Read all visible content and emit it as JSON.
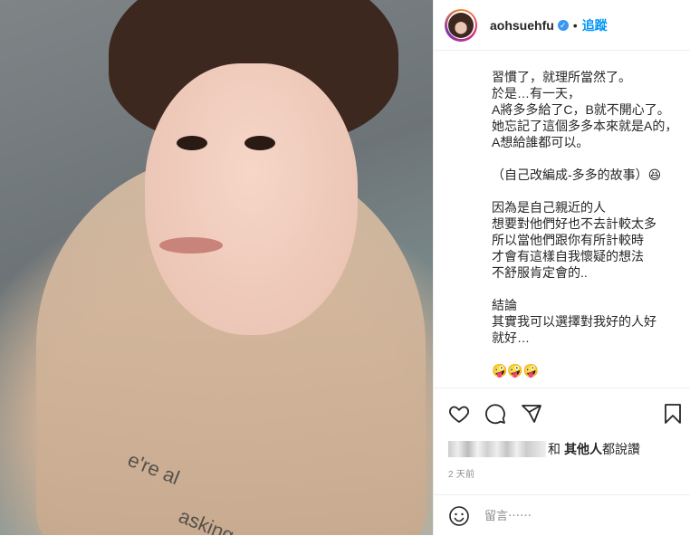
{
  "photo": {
    "slogan_line1": "e're al",
    "slogan_line2": "asking"
  },
  "header": {
    "username": "aohsuehfu",
    "verified_mark": "✓",
    "separator": "•",
    "follow_label": "追蹤"
  },
  "caption": {
    "text": "習慣了，就理所當然了。\n於是…有一天，\nA將多多給了C，B就不開心了。\n她忘記了這個多多本來就是A的，\nA想給誰都可以。\n\n（自己改編成-多多的故事）😆\n\n因為是自己親近的人\n想要對他們好也不去計較太多\n所以當他們跟你有所計較時\n才會有這樣自我懷疑的想法\n不舒服肯定會的..\n\n結論\n其實我可以選擇對我好的人好\n就好…\n\n🤪🤪🤪"
  },
  "likes": {
    "prefix": "和",
    "others": "其他人",
    "suffix": " 都說讚"
  },
  "time": {
    "label": "2 天前"
  },
  "comment": {
    "placeholder": "留言⋯⋯"
  },
  "icons": {
    "heart": "heart-icon",
    "comment": "comment-icon",
    "share": "share-icon",
    "save": "bookmark-icon",
    "emoji": "emoji-icon"
  },
  "colors": {
    "accent": "#0095f6",
    "verified": "#3897f0",
    "border": "#efefef",
    "muted": "#8e8e8e"
  }
}
